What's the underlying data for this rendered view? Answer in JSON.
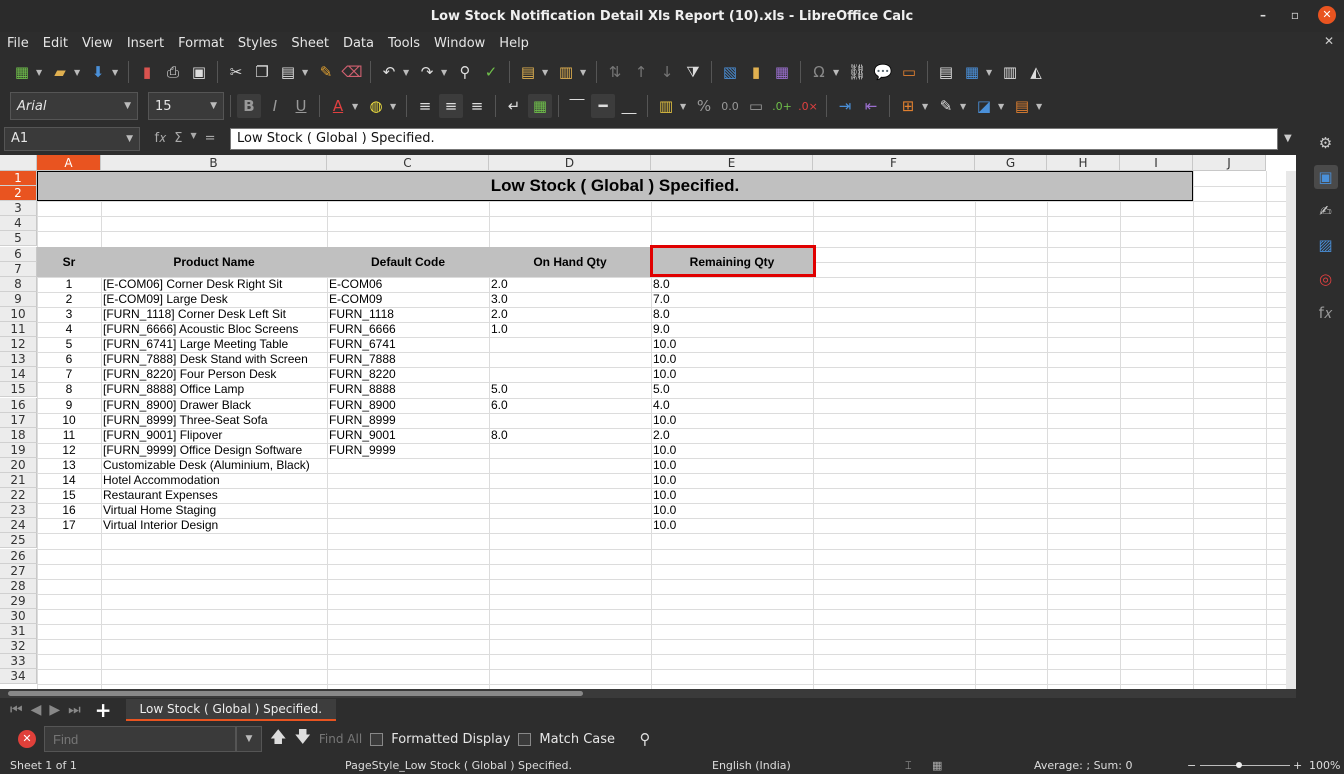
{
  "window": {
    "title": "Low Stock Notification Detail Xls Report (10).xls - LibreOffice Calc",
    "minimize": "–",
    "restore": "▫",
    "close": "✕"
  },
  "menu": [
    "File",
    "Edit",
    "View",
    "Insert",
    "Format",
    "Styles",
    "Sheet",
    "Data",
    "Tools",
    "Window",
    "Help"
  ],
  "menu_close": "✕",
  "font": {
    "name": "Arial",
    "size": "15"
  },
  "formula_bar": {
    "cell_ref": "A1",
    "content": "Low Stock ( Global ) Specified."
  },
  "columns": [
    "A",
    "B",
    "C",
    "D",
    "E",
    "F",
    "G",
    "H",
    "I",
    "J"
  ],
  "rows": [
    "1",
    "2",
    "3",
    "4",
    "5",
    "6",
    "7",
    "8",
    "9",
    "10",
    "11",
    "12",
    "13",
    "14",
    "15",
    "16",
    "17",
    "18",
    "19",
    "20",
    "21",
    "22",
    "23",
    "24",
    "25",
    "26",
    "27",
    "28",
    "29",
    "30",
    "31",
    "32",
    "33",
    "34"
  ],
  "sheet": {
    "title": "Low Stock ( Global ) Specified.",
    "headers": {
      "sr": "Sr",
      "product": "Product Name",
      "code": "Default Code",
      "onhand": "On Hand Qty",
      "remaining": "Remaining Qty"
    },
    "data": [
      {
        "sr": "1",
        "product": "[E-COM06] Corner Desk Right Sit",
        "code": "E-COM06",
        "onhand": "2.0",
        "remaining": "8.0"
      },
      {
        "sr": "2",
        "product": "[E-COM09] Large Desk",
        "code": "E-COM09",
        "onhand": "3.0",
        "remaining": "7.0"
      },
      {
        "sr": "3",
        "product": "[FURN_1118] Corner Desk Left Sit",
        "code": "FURN_1118",
        "onhand": "2.0",
        "remaining": "8.0"
      },
      {
        "sr": "4",
        "product": "[FURN_6666] Acoustic Bloc Screens",
        "code": "FURN_6666",
        "onhand": "1.0",
        "remaining": "9.0"
      },
      {
        "sr": "5",
        "product": "[FURN_6741] Large Meeting Table",
        "code": "FURN_6741",
        "onhand": "",
        "remaining": "10.0"
      },
      {
        "sr": "6",
        "product": "[FURN_7888] Desk Stand with Screen",
        "code": "FURN_7888",
        "onhand": "",
        "remaining": "10.0"
      },
      {
        "sr": "7",
        "product": "[FURN_8220] Four Person Desk",
        "code": "FURN_8220",
        "onhand": "",
        "remaining": "10.0"
      },
      {
        "sr": "8",
        "product": "[FURN_8888] Office Lamp",
        "code": "FURN_8888",
        "onhand": "5.0",
        "remaining": "5.0"
      },
      {
        "sr": "9",
        "product": "[FURN_8900] Drawer Black",
        "code": "FURN_8900",
        "onhand": "6.0",
        "remaining": "4.0"
      },
      {
        "sr": "10",
        "product": "[FURN_8999] Three-Seat Sofa",
        "code": "FURN_8999",
        "onhand": "",
        "remaining": "10.0"
      },
      {
        "sr": "11",
        "product": "[FURN_9001] Flipover",
        "code": "FURN_9001",
        "onhand": "8.0",
        "remaining": "2.0"
      },
      {
        "sr": "12",
        "product": "[FURN_9999] Office Design Software",
        "code": "FURN_9999",
        "onhand": "",
        "remaining": "10.0"
      },
      {
        "sr": "13",
        "product": "Customizable Desk (Aluminium, Black)",
        "code": "",
        "onhand": "",
        "remaining": "10.0"
      },
      {
        "sr": "14",
        "product": "Hotel Accommodation",
        "code": "",
        "onhand": "",
        "remaining": "10.0"
      },
      {
        "sr": "15",
        "product": "Restaurant Expenses",
        "code": "",
        "onhand": "",
        "remaining": "10.0"
      },
      {
        "sr": "16",
        "product": "Virtual Home Staging",
        "code": "",
        "onhand": "",
        "remaining": "10.0"
      },
      {
        "sr": "17",
        "product": "Virtual Interior Design",
        "code": "",
        "onhand": "",
        "remaining": "10.0"
      }
    ]
  },
  "tabs": {
    "active": "Low Stock ( Global ) Specified."
  },
  "find": {
    "placeholder": "Find",
    "find_all": "Find All",
    "formatted_display": "Formatted Display",
    "match_case": "Match Case"
  },
  "status": {
    "sheet": "Sheet 1 of 1",
    "page_style": "PageStyle_Low Stock ( Global ) Specified.",
    "language": "English (India)",
    "summary": "Average: ; Sum: 0",
    "zoom_minus": "−",
    "zoom_plus": "+",
    "zoom": "100%"
  },
  "colors": {
    "accent": "#e95420",
    "header_fill": "#c0c0c0",
    "highlight": "#e00000"
  }
}
